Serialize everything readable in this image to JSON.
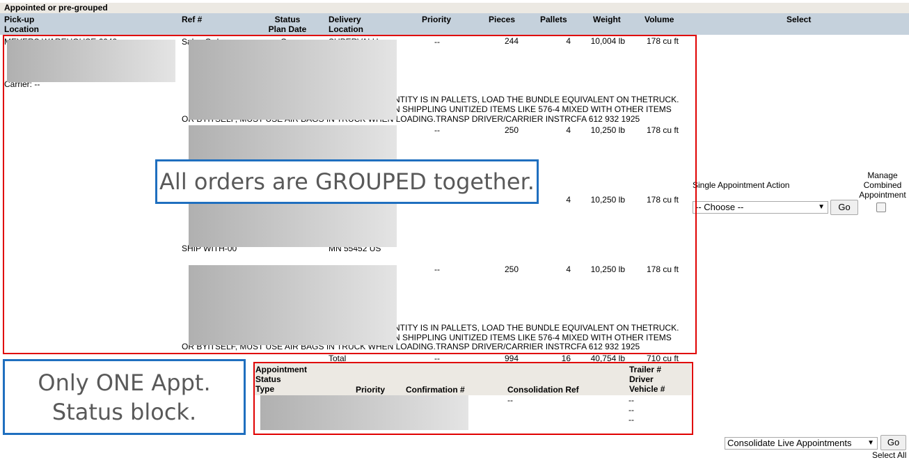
{
  "section_title": "Appointed or pre-grouped",
  "columns": {
    "pickup": [
      "Pick-up",
      "Location"
    ],
    "ref": "Ref #",
    "status": [
      "Status",
      "Plan Date"
    ],
    "delivery": [
      "Delivery",
      "Location"
    ],
    "priority": "Priority",
    "pieces": "Pieces",
    "pallets": "Pallets",
    "weight": "Weight",
    "volume": "Volume",
    "select": "Select"
  },
  "pickup": {
    "name": "MEYERS WAREHOUSE 6049",
    "carrier": "Carrier: --"
  },
  "orders": [
    {
      "ref_first": "Sales Order",
      "status": "Open",
      "delivery": "SUPERVALU",
      "priority": "--",
      "pieces": "244",
      "pallets": "4",
      "weight": "10,004 lb",
      "volume": "178 cu ft",
      "note1": "NTITY IS IN PALLETS, LOAD THE BUNDLE EQUIVALENT ON THETRUCK.",
      "note2": "N SHIPPLING UNITIZED ITEMS LIKE 576-4 MIXED WITH OTHER ITEMS",
      "note3": "OR BYITSELF, MUST USE AIR BAGS IN TRUCK WHEN LOADING.TRANSP DRIVER/CARRIER INSTRCFA 612 932 1925"
    },
    {
      "priority": "--",
      "pieces": "250",
      "pallets": "4",
      "weight": "10,250 lb",
      "volume": "178 cu ft"
    },
    {
      "pallets": "4",
      "weight": "10,250 lb",
      "volume": "178 cu ft",
      "ref_last": "SHIP WITH-00",
      "delivery_last": "MN 55452 US"
    },
    {
      "priority": "--",
      "pieces": "250",
      "pallets": "4",
      "weight": "10,250 lb",
      "volume": "178 cu ft",
      "note1": "NTITY IS IN PALLETS, LOAD THE BUNDLE EQUIVALENT ON THETRUCK.",
      "note2": "N SHIPPLING UNITIZED ITEMS LIKE 576-4 MIXED WITH OTHER ITEMS",
      "note3": "OR BYITSELF, MUST USE AIR BAGS IN TRUCK WHEN LOADING.TRANSP DRIVER/CARRIER INSTRCFA 612 932 1925"
    }
  ],
  "total": {
    "label": "Total",
    "priority": "--",
    "pieces": "994",
    "pallets": "16",
    "weight": "40,754 lb",
    "volume": "710 cu ft"
  },
  "single_action": {
    "label": "Single Appointment Action",
    "selected": "-- Choose --",
    "go": "Go"
  },
  "manage_combined": {
    "label": [
      "Manage",
      "Combined",
      "Appointment"
    ],
    "checked": false
  },
  "appointment": {
    "headers": {
      "type": [
        "Appointment",
        "Status",
        "Type"
      ],
      "priority": "Priority",
      "confirmation": "Confirmation #",
      "consolidation": "Consolidation Ref",
      "trailer": [
        "Trailer #",
        "Driver",
        "Vehicle #"
      ]
    },
    "consolidation_value": "--",
    "trailer_values": [
      "--",
      "--",
      "--"
    ]
  },
  "bottom": {
    "selected": "Consolidate Live Appointments",
    "go": "Go",
    "select_all": "Select All"
  },
  "annotations": {
    "grouped": "All orders are GROUPED together.",
    "one_block": [
      "Only ONE Appt.",
      "Status block."
    ]
  },
  "colors": {
    "highlight_red": "#e00000",
    "annotation_blue": "#1f6fbf",
    "header_band": "#c5d1dc"
  }
}
